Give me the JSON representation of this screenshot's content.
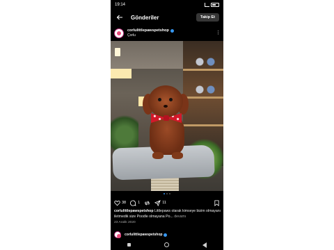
{
  "status_bar": {
    "time": "19:14"
  },
  "header": {
    "title": "Gönderiler",
    "follow_label": "Takip Et"
  },
  "post": {
    "username": "corlulittlepawspetshop",
    "location": "Çorlu",
    "likes": "38",
    "comments": "1",
    "shares": "11",
    "caption_user": "corlulittlepawspetshop",
    "caption_text": "Littlepaws olarak kimseye bizim olmayanı iletmedik size Poodle olmayana Po...",
    "caption_more": "devamı",
    "date": "23 Aralık 2020",
    "carousel": {
      "count": 3,
      "active": 1
    }
  },
  "next_post": {
    "username": "corlulittlepawspetshop"
  },
  "colors": {
    "background": "#000000",
    "verified": "#3797f0",
    "button": "#363636"
  },
  "icons": [
    "back-arrow-icon",
    "more-icon",
    "heart-icon",
    "comment-icon",
    "repost-icon",
    "send-icon",
    "bookmark-icon"
  ]
}
